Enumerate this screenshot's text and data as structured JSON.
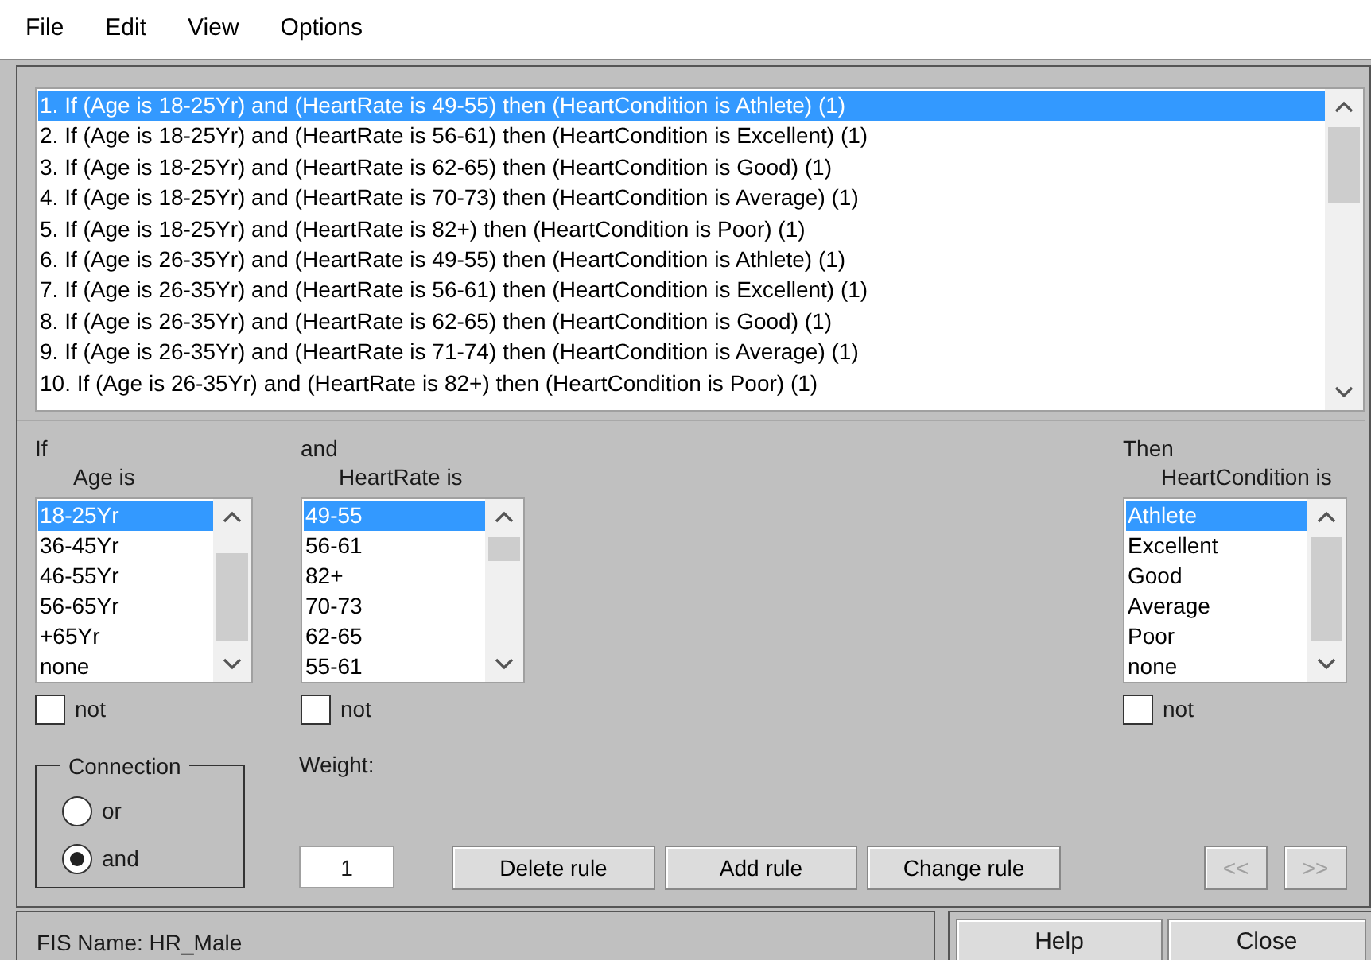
{
  "menu": [
    "File",
    "Edit",
    "View",
    "Options"
  ],
  "rules": [
    {
      "text": "1. If (Age is 18-25Yr) and (HeartRate is 49-55) then (HeartCondition is Athlete) (1)",
      "selected": true
    },
    {
      "text": "2. If (Age is 18-25Yr) and (HeartRate is 56-61) then (HeartCondition is Excellent) (1)",
      "selected": false
    },
    {
      "text": "3. If (Age is 18-25Yr) and (HeartRate is 62-65) then (HeartCondition is Good) (1)",
      "selected": false
    },
    {
      "text": "4. If (Age is 18-25Yr) and (HeartRate is 70-73) then (HeartCondition is Average) (1)",
      "selected": false
    },
    {
      "text": "5. If (Age is 18-25Yr) and (HeartRate is 82+) then (HeartCondition is Poor) (1)",
      "selected": false
    },
    {
      "text": "6. If (Age is 26-35Yr) and (HeartRate is 49-55) then (HeartCondition is Athlete) (1)",
      "selected": false
    },
    {
      "text": "7. If (Age is 26-35Yr) and (HeartRate is 56-61) then (HeartCondition is Excellent) (1)",
      "selected": false
    },
    {
      "text": "8. If (Age is 26-35Yr) and (HeartRate is 62-65) then (HeartCondition is Good) (1)",
      "selected": false
    },
    {
      "text": "9. If (Age is 26-35Yr) and (HeartRate is 71-74) then (HeartCondition is Average) (1)",
      "selected": false
    },
    {
      "text": "10. If (Age is 26-35Yr) and (HeartRate is 82+) then (HeartCondition is Poor) (1)",
      "selected": false
    }
  ],
  "inputs": [
    {
      "prefix": "If",
      "label": "Age is",
      "items": [
        {
          "text": "18-25Yr",
          "selected": true
        },
        {
          "text": "36-45Yr",
          "selected": false
        },
        {
          "text": "46-55Yr",
          "selected": false
        },
        {
          "text": "56-65Yr",
          "selected": false
        },
        {
          "text": "+65Yr",
          "selected": false
        },
        {
          "text": "none",
          "selected": false
        }
      ],
      "not_label": "not",
      "not_checked": false
    },
    {
      "prefix": "and",
      "label": "HeartRate is",
      "items": [
        {
          "text": "49-55",
          "selected": true
        },
        {
          "text": "56-61",
          "selected": false
        },
        {
          "text": "82+",
          "selected": false
        },
        {
          "text": "70-73",
          "selected": false
        },
        {
          "text": "62-65",
          "selected": false
        },
        {
          "text": "55-61",
          "selected": false
        }
      ],
      "not_label": "not",
      "not_checked": false
    }
  ],
  "output": {
    "prefix": "Then",
    "label": "HeartCondition is",
    "items": [
      {
        "text": "Athlete",
        "selected": true
      },
      {
        "text": "Excellent",
        "selected": false
      },
      {
        "text": "Good",
        "selected": false
      },
      {
        "text": "Average",
        "selected": false
      },
      {
        "text": "Poor",
        "selected": false
      },
      {
        "text": "none",
        "selected": false
      }
    ],
    "not_label": "not",
    "not_checked": false
  },
  "connection": {
    "title": "Connection",
    "options": [
      {
        "label": "or",
        "selected": false
      },
      {
        "label": "and",
        "selected": true
      }
    ]
  },
  "weight": {
    "label": "Weight:",
    "value": "1"
  },
  "buttons": [
    "Delete rule",
    "Add rule",
    "Change rule"
  ],
  "nav_buttons": [
    {
      "label": "<<",
      "disabled": true
    },
    {
      "label": ">>",
      "disabled": true
    }
  ],
  "status": "FIS Name: HR_Male",
  "footer_buttons": [
    "Help",
    "Close"
  ]
}
